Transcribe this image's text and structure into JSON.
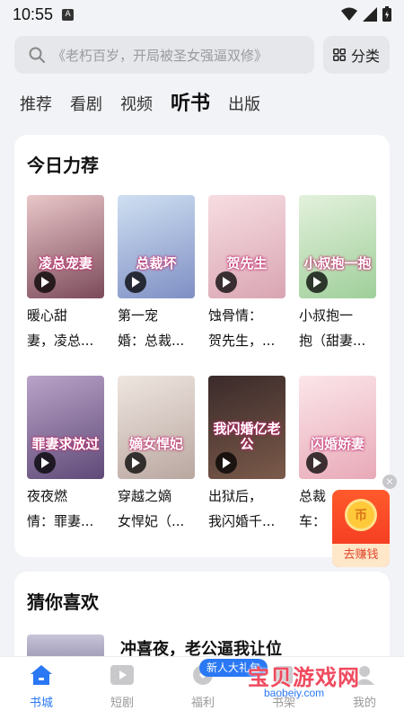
{
  "status_bar": {
    "time": "10:55",
    "notification_glyph": "A"
  },
  "search": {
    "placeholder": "《老朽百岁，开局被圣女强逼双修》"
  },
  "category_button": {
    "label": "分类"
  },
  "tabs": [
    {
      "label": "推荐"
    },
    {
      "label": "看剧"
    },
    {
      "label": "视频"
    },
    {
      "label": "听书",
      "active": true
    },
    {
      "label": "出版"
    }
  ],
  "recommend": {
    "title": "今日力荐",
    "books": [
      {
        "line1": "暖心甜",
        "line2": "妻，凌总...",
        "cover_text": "凌总宠妻",
        "cover_colors": [
          "#e9c7c9",
          "#7c4a5a"
        ]
      },
      {
        "line1": "第一宠",
        "line2": "婚：总裁...",
        "cover_text": "总裁坏",
        "cover_colors": [
          "#cfe0f2",
          "#7f8fc4"
        ]
      },
      {
        "line1": "蚀骨情：",
        "line2": "贺先生，...",
        "cover_text": "贺先生",
        "cover_colors": [
          "#f7dde2",
          "#d9a5b3"
        ]
      },
      {
        "line1": "小叔抱一",
        "line2": "抱（甜妻...",
        "cover_text": "小叔抱一抱",
        "cover_colors": [
          "#e3f1dc",
          "#9fcf9a"
        ]
      },
      {
        "line1": "夜夜燃",
        "line2": "情：罪妻...",
        "cover_text": "罪妻求放过",
        "cover_colors": [
          "#b9a3c8",
          "#5f4a78"
        ]
      },
      {
        "line1": "穿越之嫡",
        "line2": "女悍妃（...",
        "cover_text": "嫡女悍妃",
        "cover_colors": [
          "#efe6e0",
          "#b9a7a0"
        ]
      },
      {
        "line1": "出狱后，",
        "line2": "我闪婚千...",
        "cover_text": "我闪婚亿老公",
        "cover_colors": [
          "#3a2a2a",
          "#7b5a4a"
        ]
      },
      {
        "line1": "总裁",
        "line2": "车：",
        "cover_text": "闪婚娇妻",
        "cover_colors": [
          "#fbe6ea",
          "#e8a9b7"
        ]
      }
    ]
  },
  "guess": {
    "title": "猜你喜欢",
    "first_item": "冲喜夜，老公逼我让位"
  },
  "reward": {
    "coin": "币",
    "label": "去赚钱",
    "close": "×"
  },
  "gift_badge": "新人大礼包",
  "bottom_nav": [
    {
      "label": "书城",
      "icon": "home-icon",
      "active": true
    },
    {
      "label": "短剧",
      "icon": "play-icon"
    },
    {
      "label": "福利",
      "icon": "gift-icon"
    },
    {
      "label": "书架",
      "icon": "shelf-icon"
    },
    {
      "label": "我的",
      "icon": "user-icon"
    }
  ],
  "watermark": {
    "text": "宝贝游戏网",
    "url": "baobeiy.com"
  },
  "colors": {
    "accent": "#2a78f4",
    "reward": "#f1341f"
  }
}
